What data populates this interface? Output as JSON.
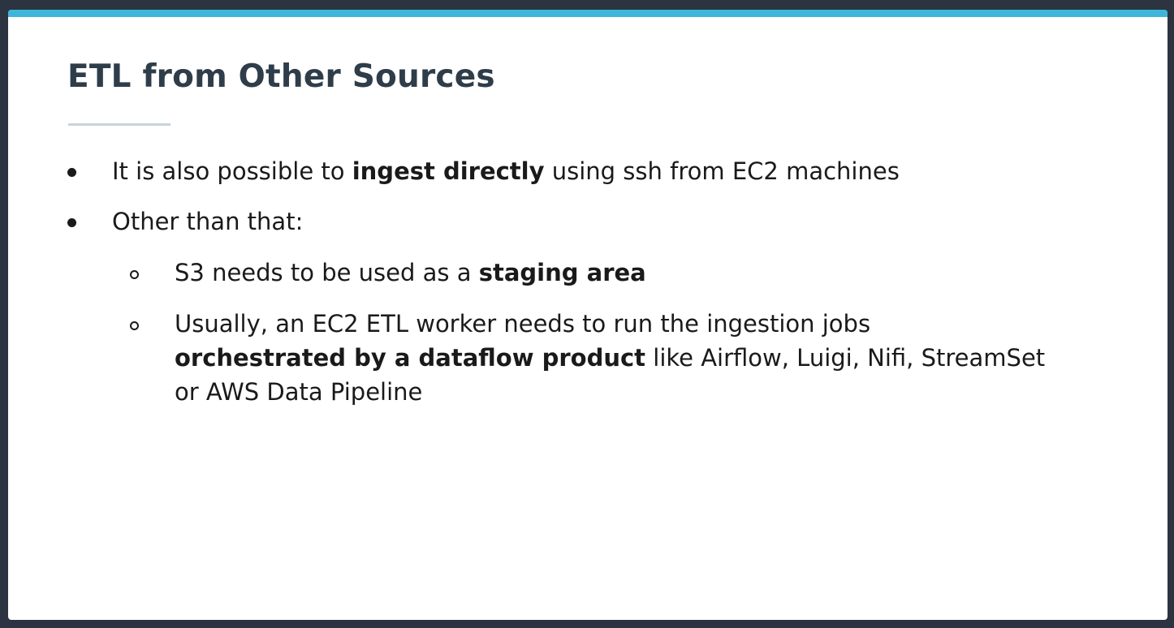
{
  "slide": {
    "title": "ETL from Other Sources",
    "accent_color": "#3fb6d9",
    "title_color": "#2e3d49",
    "bullets": [
      {
        "pre": "It is also possible to ",
        "bold": "ingest directly",
        "post": " using ssh from EC2 machines"
      },
      {
        "text": "Other than that:"
      }
    ],
    "sub_bullets": [
      {
        "pre": "S3 needs to be used as a ",
        "bold": "staging area"
      },
      {
        "line1": "Usually, an EC2 ETL worker needs to run the ingestion jobs",
        "bold": "orchestrated by a dataflow product",
        "line2_post": " like Airflow, Luigi, Nifi, StreamSet",
        "line3": "or AWS Data Pipeline"
      }
    ]
  }
}
